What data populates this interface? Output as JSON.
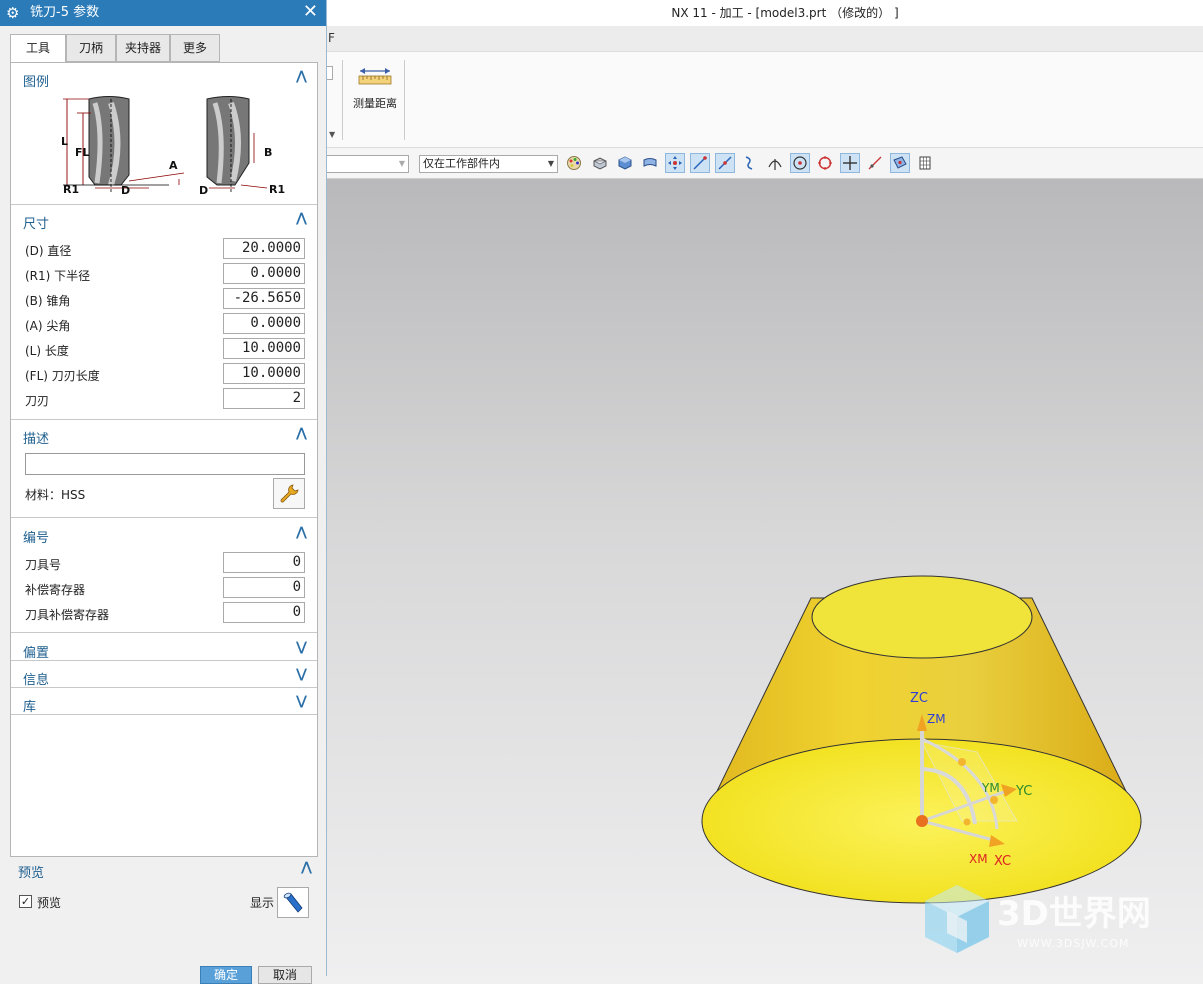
{
  "window": {
    "title": "NX 11 - 加工 - [model3.prt （修改的） ]"
  },
  "ribbon": {
    "tab_fragment": "F",
    "measure_label": "测量距离"
  },
  "filterbar": {
    "type_filter_value": "",
    "scope_filter_value": "仅在工作部件内"
  },
  "dialog": {
    "title": "铣刀-5 参数",
    "tabs": [
      {
        "label": "工具",
        "active": true
      },
      {
        "label": "刀柄",
        "active": false
      },
      {
        "label": "夹持器",
        "active": false
      },
      {
        "label": "更多",
        "active": false
      }
    ],
    "sections": {
      "legend": {
        "title": "图例",
        "expanded": true
      },
      "dimensions": {
        "title": "尺寸",
        "expanded": true
      },
      "description": {
        "title": "描述",
        "expanded": true
      },
      "numbering": {
        "title": "编号",
        "expanded": true
      },
      "offset": {
        "title": "偏置",
        "expanded": false
      },
      "info": {
        "title": "信息",
        "expanded": false
      },
      "library": {
        "title": "库",
        "expanded": false
      }
    },
    "legend_labels": {
      "L": "L",
      "FL": "FL",
      "A": "A",
      "R1": "R1",
      "D": "D",
      "B": "B"
    },
    "dimensions": [
      {
        "label": "(D) 直径",
        "value": "20.0000"
      },
      {
        "label": "(R1) 下半径",
        "value": "0.0000"
      },
      {
        "label": "(B) 锥角",
        "value": "-26.5650"
      },
      {
        "label": "(A) 尖角",
        "value": "0.0000"
      },
      {
        "label": "(L) 长度",
        "value": "10.0000"
      },
      {
        "label": "(FL) 刀刃长度",
        "value": "10.0000"
      },
      {
        "label": "刀刃",
        "value": "2"
      }
    ],
    "description": {
      "text": "",
      "material": "材料：HSS"
    },
    "numbering": [
      {
        "label": "刀具号",
        "value": "0"
      },
      {
        "label": "补偿寄存器",
        "value": "0"
      },
      {
        "label": "刀具补偿寄存器",
        "value": "0"
      }
    ],
    "preview": {
      "title": "预览",
      "checkbox_label": "预览",
      "checked": true,
      "show_label": "显示"
    },
    "buttons": {
      "ok": "确定",
      "cancel": "取消"
    }
  },
  "viewport": {
    "axes": {
      "zc": "ZC",
      "zm": "ZM",
      "ym": "YM",
      "yc": "YC",
      "xm": "XM",
      "xc": "XC"
    },
    "colors": {
      "solid": "#f2e21a",
      "solid_side": "#e6c72a",
      "background_top": "#b9b9bb",
      "background_bottom": "#efeff0"
    }
  },
  "watermark": {
    "brand": "3D世界网",
    "url": "WWW.3DSJW.COM"
  }
}
